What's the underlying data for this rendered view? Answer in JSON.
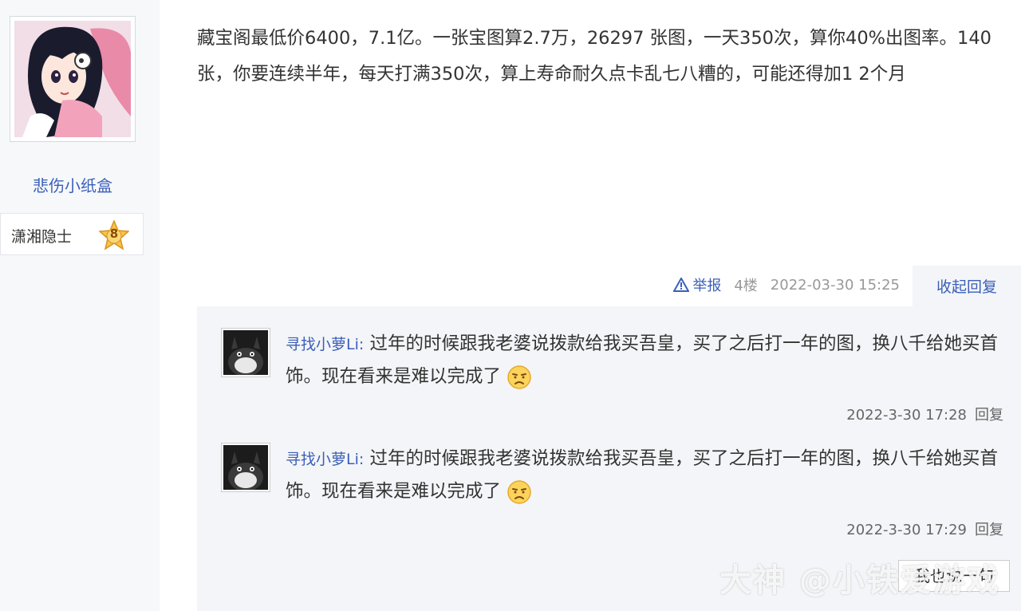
{
  "author": {
    "name": "悲伤小纸盒",
    "title": "潇湘隐士",
    "level": "8"
  },
  "post": {
    "content": "藏宝阁最低价6400，7.1亿。一张宝图算2.7万，26297 张图，一天350次，算你40%出图率。140张，你要连续半年，每天打满350次，算上寿命耐久点卡乱七八糟的，可能还得加1 2个月",
    "report_label": "举报",
    "floor": "4楼",
    "datetime": "2022-03-30 15:25",
    "collapse_label": "收起回复"
  },
  "replies": [
    {
      "user": "寻找小萝Li:",
      "text": "过年的时候跟我老婆说拨款给我买吾皇，买了之后打一年的图，换八千给她买首饰。现在看来是难以完成了",
      "time": "2022-3-30 17:28",
      "reply_label": "回复"
    },
    {
      "user": "寻找小萝Li:",
      "text": "过年的时候跟我老婆说拨款给我买吾皇，买了之后打一年的图，换八千给她买首饰。现在看来是难以完成了",
      "time": "2022-3-30 17:29",
      "reply_label": "回复"
    }
  ],
  "reply_input_label": "我也说一句",
  "watermark": "大神 @小铁爱游戏",
  "colors": {
    "link": "#3a5fb8",
    "reply_bg": "#f4f5f8",
    "sidebar_bg": "#f7f8fa"
  }
}
